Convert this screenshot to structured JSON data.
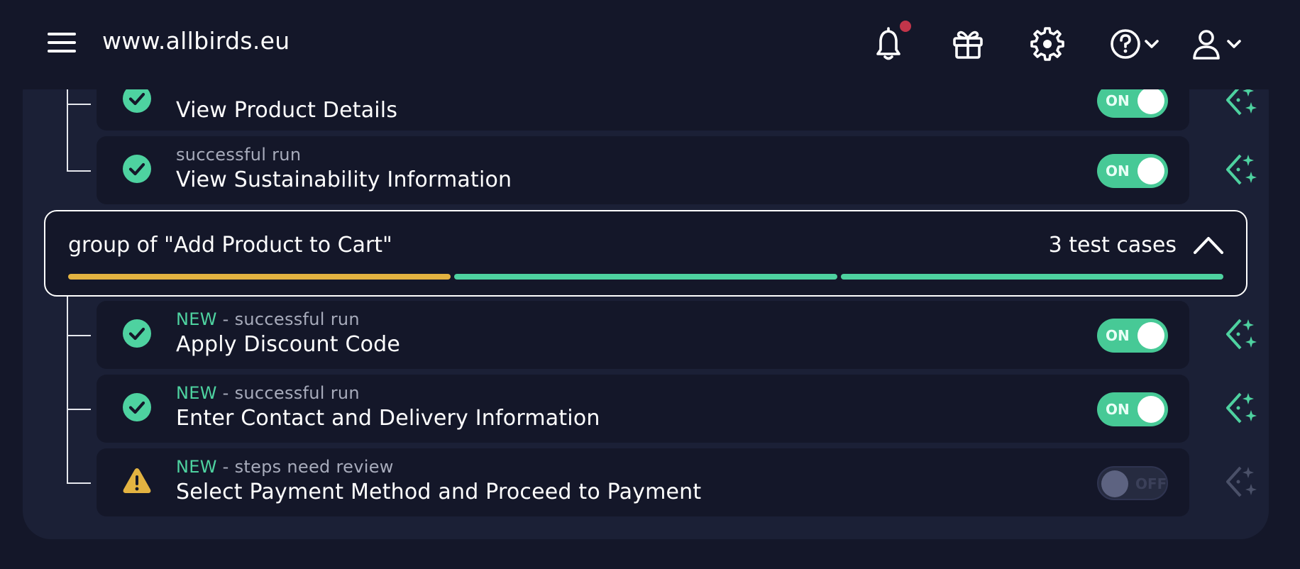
{
  "header": {
    "site": "www.allbirds.eu",
    "icons": [
      "menu-icon",
      "bell-icon",
      "gift-icon",
      "settings-icon",
      "help-icon",
      "user-icon"
    ]
  },
  "cards_top": [
    {
      "sub_prefix": "",
      "sub": "",
      "title": "View Product Details",
      "status": "success",
      "toggle": "ON"
    },
    {
      "sub_prefix": "",
      "sub": "successful run",
      "title": "View Sustainability Information",
      "status": "success",
      "toggle": "ON"
    }
  ],
  "group": {
    "title": "group of \"Add Product to Cart\"",
    "count": "3 test cases",
    "segments": [
      "warning",
      "success",
      "success"
    ]
  },
  "cards_group": [
    {
      "sub_prefix": "NEW",
      "sub": " - successful run",
      "title": "Apply Discount Code",
      "status": "success",
      "toggle": "ON"
    },
    {
      "sub_prefix": "NEW",
      "sub": " - successful run",
      "title": "Enter Contact and Delivery Information",
      "status": "success",
      "toggle": "ON"
    },
    {
      "sub_prefix": "NEW",
      "sub": " - steps need review",
      "title": "Select Payment Method and Proceed to Payment",
      "status": "warning",
      "toggle": "OFF"
    }
  ],
  "colors": {
    "background": "#141729",
    "panel": "#1b2036",
    "success": "#4ed2a0",
    "warning": "#e3b341",
    "notification": "#c2354a"
  }
}
